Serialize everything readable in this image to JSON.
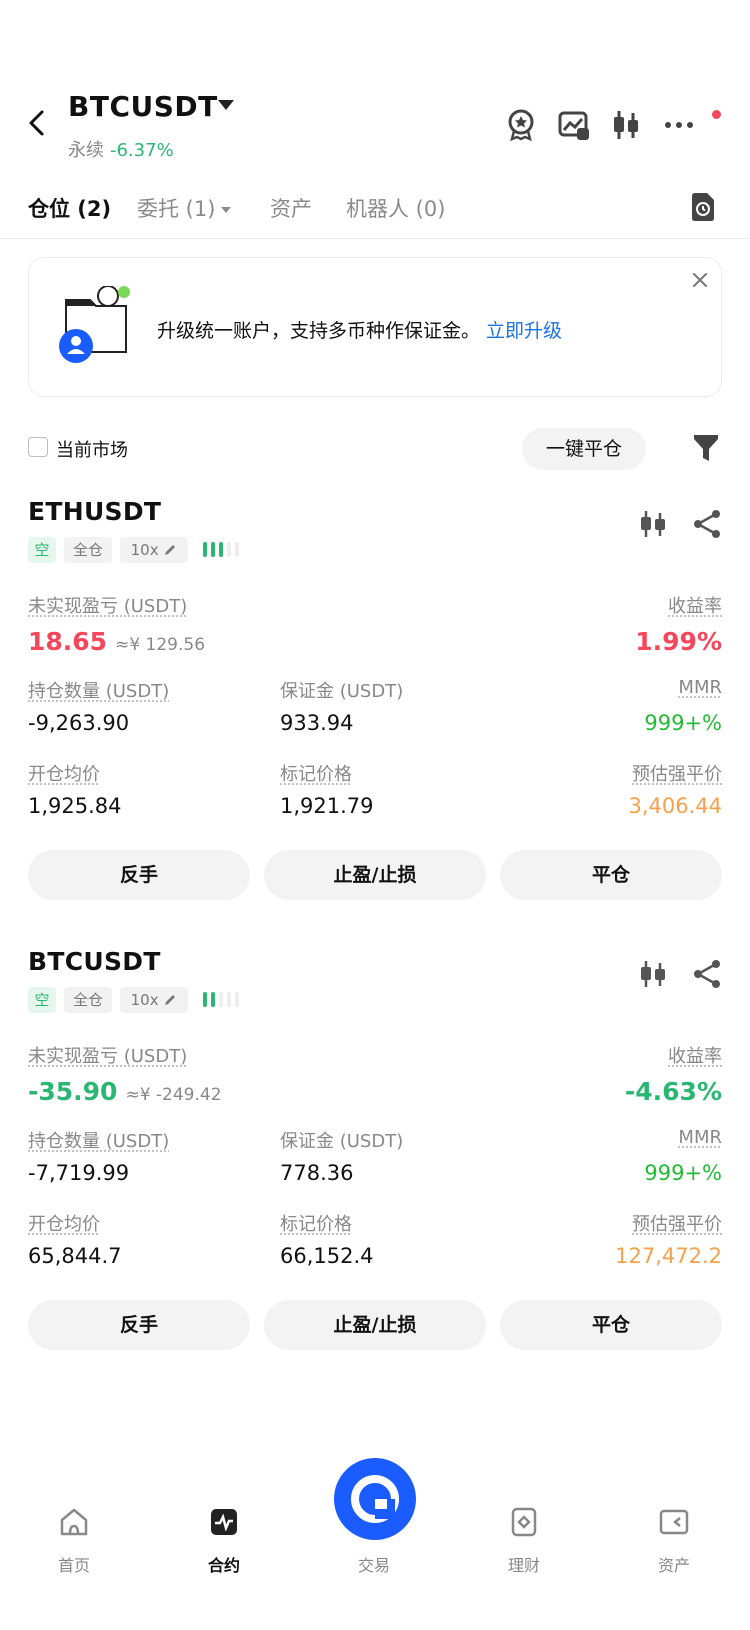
{
  "header": {
    "symbol": "BTCUSDT",
    "contract_type": "永续",
    "change": "-6.37%"
  },
  "tabs": [
    {
      "label": "仓位 (2)"
    },
    {
      "label": "委托 (1)"
    },
    {
      "label": "资产"
    },
    {
      "label": "机器人 (0)"
    }
  ],
  "banner": {
    "text": "升级统一账户，支持多币种作保证金。",
    "link": "立即升级"
  },
  "filter": {
    "checkbox_label": "当前市场",
    "close_all": "一键平仓"
  },
  "positions": [
    {
      "symbol": "ETHUSDT",
      "side": "空",
      "margin_mode": "全仓",
      "leverage": "10x",
      "adl_level": 3,
      "pnl_label": "未实现盈亏 (USDT)",
      "pnl": "18.65",
      "pnl_cny": "≈¥ 129.56",
      "roe_label": "收益率",
      "roe": "1.99%",
      "size_label": "持仓数量 (USDT)",
      "size": "-9,263.90",
      "margin_label": "保证金 (USDT)",
      "margin": "933.94",
      "mmr_label": "MMR",
      "mmr": "999+%",
      "entry_label": "开仓均价",
      "entry": "1,925.84",
      "mark_label": "标记价格",
      "mark": "1,921.79",
      "liq_label": "预估强平价",
      "liq": "3,406.44",
      "btn_reverse": "反手",
      "btn_tpsl": "止盈/止损",
      "btn_close": "平仓"
    },
    {
      "symbol": "BTCUSDT",
      "side": "空",
      "margin_mode": "全仓",
      "leverage": "10x",
      "adl_level": 2,
      "pnl_label": "未实现盈亏 (USDT)",
      "pnl": "-35.90",
      "pnl_cny": "≈¥ -249.42",
      "roe_label": "收益率",
      "roe": "-4.63%",
      "size_label": "持仓数量 (USDT)",
      "size": "-7,719.99",
      "margin_label": "保证金 (USDT)",
      "margin": "778.36",
      "mmr_label": "MMR",
      "mmr": "999+%",
      "entry_label": "开仓均价",
      "entry": "65,844.7",
      "mark_label": "标记价格",
      "mark": "66,152.4",
      "liq_label": "预估强平价",
      "liq": "127,472.2",
      "btn_reverse": "反手",
      "btn_tpsl": "止盈/止损",
      "btn_close": "平仓"
    }
  ],
  "bottom_nav": [
    {
      "label": "首页",
      "icon": "home-icon"
    },
    {
      "label": "合约",
      "icon": "futures-icon"
    },
    {
      "label": "交易",
      "icon": "trade-icon"
    },
    {
      "label": "理财",
      "icon": "earn-icon"
    },
    {
      "label": "资产",
      "icon": "wallet-icon"
    }
  ],
  "colors": {
    "accent": "#1a5cff",
    "profit": "#2bb673",
    "loss": "#f5475b",
    "liq": "#f7a04b"
  }
}
